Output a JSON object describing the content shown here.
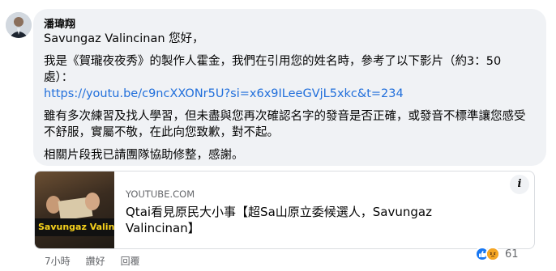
{
  "comment": {
    "author": "潘瑋翔",
    "paragraphs": [
      "Savungaz Valincinan 您好，",
      "我是《賀瓏夜夜秀》的製作人霍金，我們在引用您的姓名時，參考了以下影片（約3：50處）：",
      "https://youtu.be/c9ncXXONr5U?si=x6x9ILeeGVjL5xkc&t=234",
      "雖有多次練習及找人學習，但未盡與您再次確認名字的發音是否正確，或發音不標準讓您感受不舒服，實屬不敬，在此向您致歉，對不起。",
      "相關片段我已請團隊協助修整，感謝。"
    ]
  },
  "link_preview": {
    "domain": "YOUTUBE.COM",
    "title": "Qtai看見原民大小事【超Sa山原立委候選人，Savungaz Valincinan】",
    "thumbnail_text": "Savungaz Valincinan",
    "info_icon": "i"
  },
  "actions": {
    "time": "7小時",
    "like": "讚好",
    "reply": "回覆"
  },
  "reactions": {
    "count": "61",
    "icons": [
      "like-icon",
      "angry-icon"
    ]
  },
  "colors": {
    "bubble_bg": "#f0f2f5",
    "link": "#216fdb",
    "like_blue": "#1877f2",
    "angry_orange": "#e9710f"
  }
}
